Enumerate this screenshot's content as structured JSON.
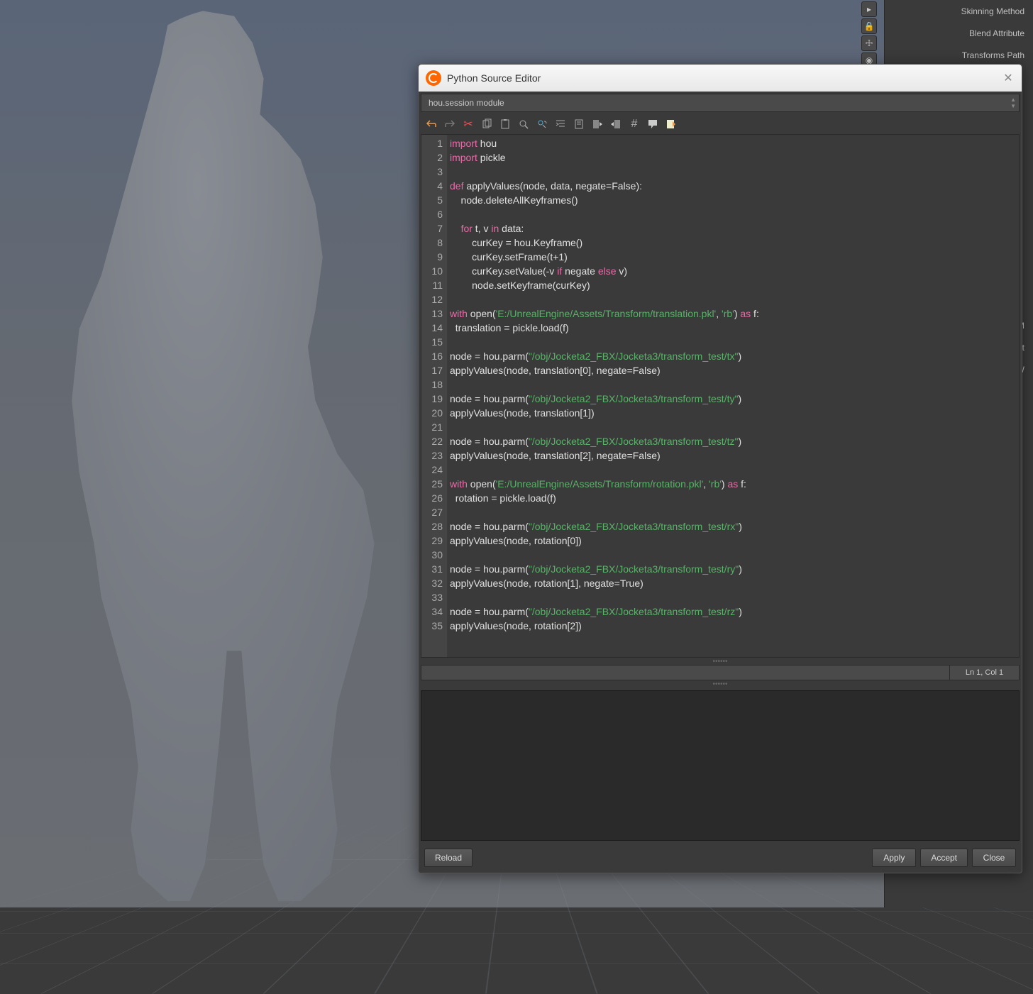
{
  "side_panel": {
    "params": [
      {
        "label": "Skinning Method"
      },
      {
        "label": "Blend Attribute"
      },
      {
        "label": "Transforms Path"
      }
    ],
    "partial_labels": [
      "M",
      "ket",
      "W"
    ]
  },
  "editor": {
    "title": "Python Source Editor",
    "module_label": "hou.session module",
    "toolbar": {
      "undo": "undo",
      "redo": "redo",
      "cut": "cut",
      "copy": "copy",
      "paste": "paste",
      "find": "find",
      "replace": "replace",
      "indent": "indent",
      "outdent": "outdent",
      "comment": "comment",
      "help": "help",
      "tooltip": "tooltip",
      "edit": "edit"
    },
    "code_lines": [
      {
        "n": 1,
        "tokens": [
          {
            "t": "import",
            "c": "kw-import"
          },
          {
            "t": " hou"
          }
        ]
      },
      {
        "n": 2,
        "tokens": [
          {
            "t": "import",
            "c": "kw-import"
          },
          {
            "t": " pickle"
          }
        ]
      },
      {
        "n": 3,
        "tokens": []
      },
      {
        "n": 4,
        "tokens": [
          {
            "t": "def",
            "c": "kw-def"
          },
          {
            "t": " applyValues(node, data, negate=False):"
          }
        ]
      },
      {
        "n": 5,
        "tokens": [
          {
            "t": "    node.deleteAllKeyframes()"
          }
        ]
      },
      {
        "n": 6,
        "tokens": []
      },
      {
        "n": 7,
        "tokens": [
          {
            "t": "    "
          },
          {
            "t": "for",
            "c": "kw-for"
          },
          {
            "t": " t, v "
          },
          {
            "t": "in",
            "c": "kw-in"
          },
          {
            "t": " data:"
          }
        ]
      },
      {
        "n": 8,
        "tokens": [
          {
            "t": "        curKey = hou.Keyframe()"
          }
        ]
      },
      {
        "n": 9,
        "tokens": [
          {
            "t": "        curKey.setFrame(t+1)"
          }
        ]
      },
      {
        "n": 10,
        "tokens": [
          {
            "t": "        curKey.setValue(-v "
          },
          {
            "t": "if",
            "c": "kw-if"
          },
          {
            "t": " negate "
          },
          {
            "t": "else",
            "c": "kw-else"
          },
          {
            "t": " v)"
          }
        ]
      },
      {
        "n": 11,
        "tokens": [
          {
            "t": "        node.setKeyframe(curKey)"
          }
        ]
      },
      {
        "n": 12,
        "tokens": []
      },
      {
        "n": 13,
        "tokens": [
          {
            "t": "with",
            "c": "kw-with"
          },
          {
            "t": " open("
          },
          {
            "t": "'E:/UnrealEngine/Assets/Transform/translation.pkl'",
            "c": "str"
          },
          {
            "t": ", "
          },
          {
            "t": "'rb'",
            "c": "str"
          },
          {
            "t": ") "
          },
          {
            "t": "as",
            "c": "kw-as"
          },
          {
            "t": " f:"
          }
        ]
      },
      {
        "n": 14,
        "tokens": [
          {
            "t": "  translation = pickle.load(f)"
          }
        ]
      },
      {
        "n": 15,
        "tokens": []
      },
      {
        "n": 16,
        "tokens": [
          {
            "t": "node = hou.parm("
          },
          {
            "t": "\"/obj/Jocketa2_FBX/Jocketa3/transform_test/tx\"",
            "c": "str"
          },
          {
            "t": ")"
          }
        ]
      },
      {
        "n": 17,
        "tokens": [
          {
            "t": "applyValues(node, translation[0], negate=False)"
          }
        ]
      },
      {
        "n": 18,
        "tokens": []
      },
      {
        "n": 19,
        "tokens": [
          {
            "t": "node = hou.parm("
          },
          {
            "t": "\"/obj/Jocketa2_FBX/Jocketa3/transform_test/ty\"",
            "c": "str"
          },
          {
            "t": ")"
          }
        ]
      },
      {
        "n": 20,
        "tokens": [
          {
            "t": "applyValues(node, translation[1])"
          }
        ]
      },
      {
        "n": 21,
        "tokens": []
      },
      {
        "n": 22,
        "tokens": [
          {
            "t": "node = hou.parm("
          },
          {
            "t": "\"/obj/Jocketa2_FBX/Jocketa3/transform_test/tz\"",
            "c": "str"
          },
          {
            "t": ")"
          }
        ]
      },
      {
        "n": 23,
        "tokens": [
          {
            "t": "applyValues(node, translation[2], negate=False)"
          }
        ]
      },
      {
        "n": 24,
        "tokens": []
      },
      {
        "n": 25,
        "tokens": [
          {
            "t": "with",
            "c": "kw-with"
          },
          {
            "t": " open("
          },
          {
            "t": "'E:/UnrealEngine/Assets/Transform/rotation.pkl'",
            "c": "str"
          },
          {
            "t": ", "
          },
          {
            "t": "'rb'",
            "c": "str"
          },
          {
            "t": ") "
          },
          {
            "t": "as",
            "c": "kw-as"
          },
          {
            "t": " f:"
          }
        ]
      },
      {
        "n": 26,
        "tokens": [
          {
            "t": "  rotation = pickle.load(f)"
          }
        ]
      },
      {
        "n": 27,
        "tokens": []
      },
      {
        "n": 28,
        "tokens": [
          {
            "t": "node = hou.parm("
          },
          {
            "t": "\"/obj/Jocketa2_FBX/Jocketa3/transform_test/rx\"",
            "c": "str"
          },
          {
            "t": ")"
          }
        ]
      },
      {
        "n": 29,
        "tokens": [
          {
            "t": "applyValues(node, rotation[0])"
          }
        ]
      },
      {
        "n": 30,
        "tokens": []
      },
      {
        "n": 31,
        "tokens": [
          {
            "t": "node = hou.parm("
          },
          {
            "t": "\"/obj/Jocketa2_FBX/Jocketa3/transform_test/ry\"",
            "c": "str"
          },
          {
            "t": ")"
          }
        ]
      },
      {
        "n": 32,
        "tokens": [
          {
            "t": "applyValues(node, rotation[1], negate=True)"
          }
        ]
      },
      {
        "n": 33,
        "tokens": []
      },
      {
        "n": 34,
        "tokens": [
          {
            "t": "node = hou.parm("
          },
          {
            "t": "\"/obj/Jocketa2_FBX/Jocketa3/transform_test/rz\"",
            "c": "str"
          },
          {
            "t": ")"
          }
        ]
      },
      {
        "n": 35,
        "tokens": [
          {
            "t": "applyValues(node, rotation[2])"
          }
        ]
      }
    ],
    "status_pos": "Ln 1, Col 1",
    "buttons": {
      "reload": "Reload",
      "apply": "Apply",
      "accept": "Accept",
      "close": "Close"
    }
  }
}
